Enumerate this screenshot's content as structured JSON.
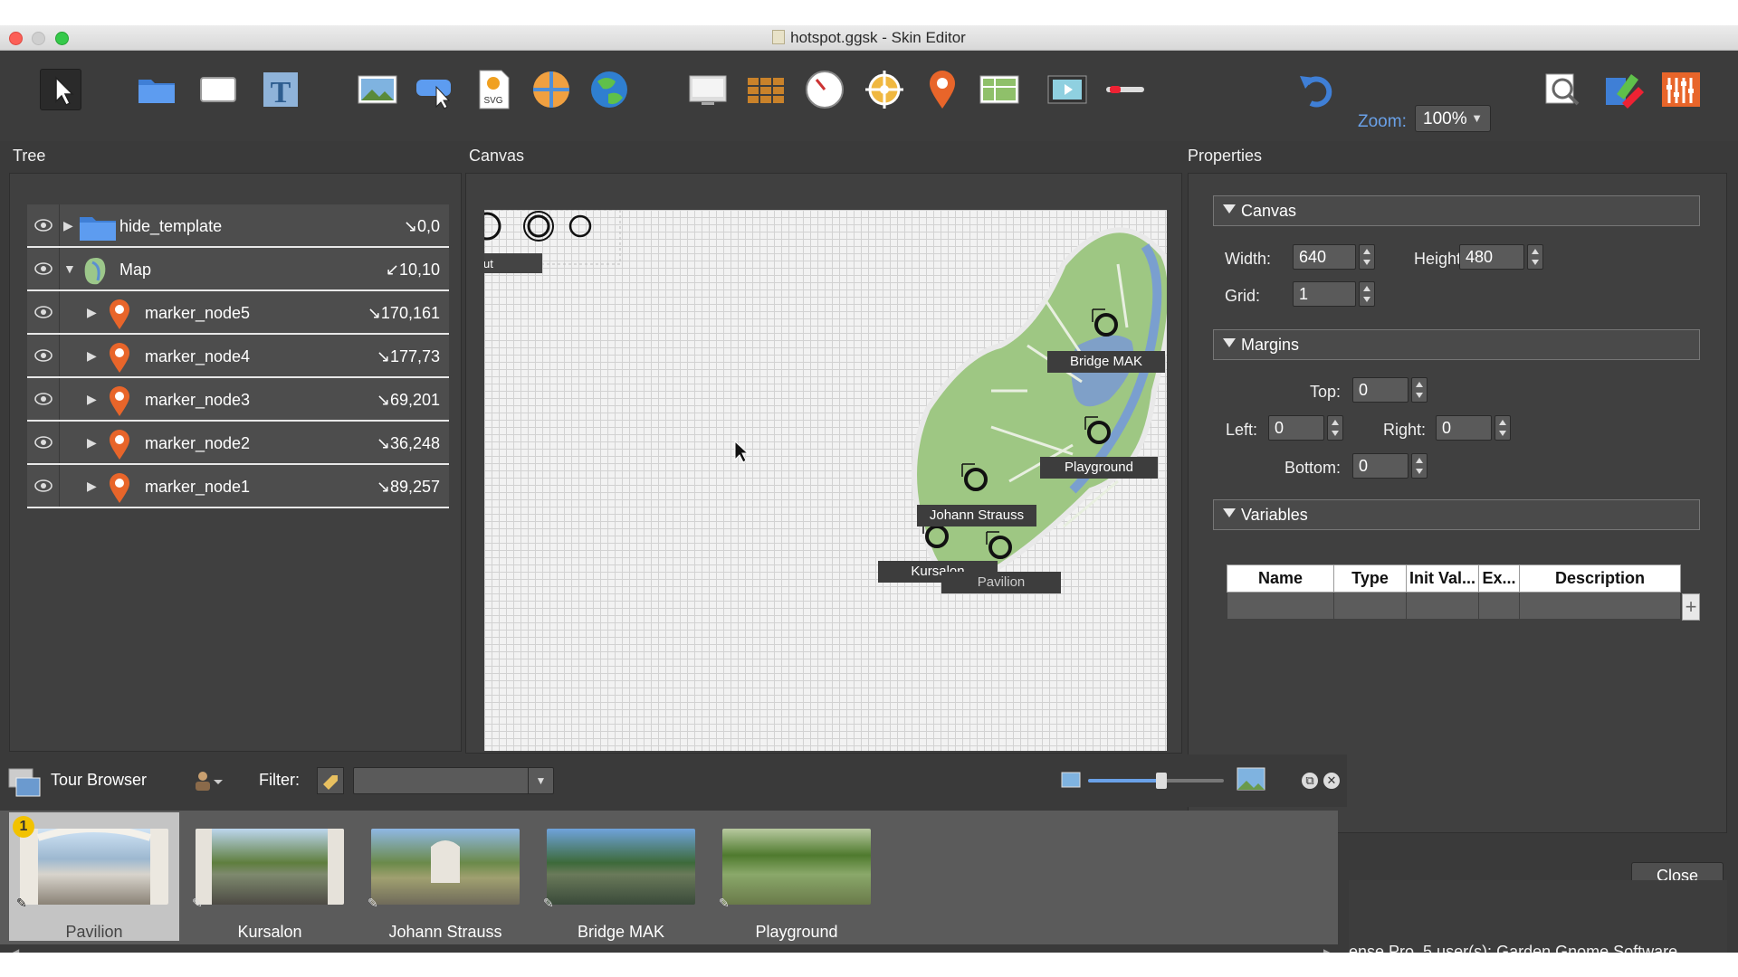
{
  "window": {
    "title": "hotspot.ggsk - Skin Editor"
  },
  "toolbar": {
    "zoom_label": "Zoom:",
    "zoom_value": "100%",
    "tools": [
      "select-tool",
      "container-tool",
      "rectangle-tool",
      "text-tool",
      "image-tool",
      "button-tool",
      "svg-tool",
      "map-tool",
      "globe-tool",
      "monitor-tool",
      "grid-tool",
      "timer-tool",
      "crosshair-tool",
      "marker-tool",
      "map-image-tool",
      "video-tool",
      "scrollbar-tool",
      "undo",
      "search-tool",
      "palette-tool",
      "config-tool"
    ]
  },
  "tree": {
    "title": "Tree",
    "rows": [
      {
        "name": "hide_template",
        "coord": "↘0,0"
      },
      {
        "name": "Map",
        "coord": "↙10,10"
      },
      {
        "name": "marker_node5",
        "coord": "↘170,161"
      },
      {
        "name": "marker_node4",
        "coord": "↘177,73"
      },
      {
        "name": "marker_node3",
        "coord": "↘69,201"
      },
      {
        "name": "marker_node2",
        "coord": "↘36,248"
      },
      {
        "name": "marker_node1",
        "coord": "↘89,257"
      }
    ]
  },
  "canvas": {
    "title": "Canvas",
    "template_label": "ut",
    "markers": [
      "Bridge MAK",
      "Playground",
      "Johann Strauss",
      "Kursalon",
      "Pavilion"
    ]
  },
  "properties": {
    "title": "Properties",
    "canvas_section": {
      "label": "Canvas",
      "width_label": "Width:",
      "width": "640",
      "height_label": "Height:",
      "height": "480",
      "grid_label": "Grid:",
      "grid": "1"
    },
    "margins_section": {
      "label": "Margins",
      "top_label": "Top:",
      "top": "0",
      "left_label": "Left:",
      "left": "0",
      "right_label": "Right:",
      "right": "0",
      "bottom_label": "Bottom:",
      "bottom": "0"
    },
    "variables_section": {
      "label": "Variables",
      "columns": [
        "Name",
        "Type",
        "Init Val...",
        "Ex...",
        "Description"
      ]
    },
    "close_label": "Close",
    "status": "ense Pro, 5 user(s): Garden Gnome Software"
  },
  "tour_browser": {
    "title": "Tour Browser",
    "filter_label": "Filter:",
    "filter_value": "",
    "badge": "1",
    "thumbnails": [
      "Pavilion",
      "Kursalon",
      "Johann Strauss",
      "Bridge MAK",
      "Playground"
    ]
  }
}
